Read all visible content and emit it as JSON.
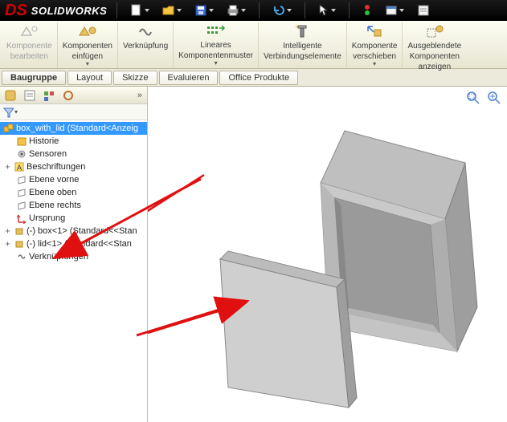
{
  "app": {
    "brand_prefix": "DS",
    "brand_name": "SOLIDWORKS"
  },
  "ribbon": {
    "groups": [
      {
        "label1": "Komponente",
        "label2": "bearbeiten",
        "gray": true
      },
      {
        "label1": "Komponenten",
        "label2": "einfügen"
      },
      {
        "label1": "Verknüpfung",
        "label2": ""
      },
      {
        "label1": "Lineares",
        "label2": "Komponentenmuster"
      },
      {
        "label1": "Intelligente",
        "label2": "Verbindungselemente"
      },
      {
        "label1": "Komponente",
        "label2": "verschieben"
      },
      {
        "label1": "Ausgeblendete",
        "label2": "Komponenten",
        "label3": "anzeigen"
      }
    ]
  },
  "tabs": [
    "Baugruppe",
    "Layout",
    "Skizze",
    "Evaluieren",
    "Office Produkte"
  ],
  "active_tab_index": 0,
  "tree": {
    "root": "box_with_lid  (Standard<Anzeig",
    "items": [
      {
        "label": "Historie"
      },
      {
        "label": "Sensoren"
      },
      {
        "label": "Beschriftungen"
      },
      {
        "label": "Ebene vorne"
      },
      {
        "label": "Ebene oben"
      },
      {
        "label": "Ebene rechts"
      },
      {
        "label": "Ursprung"
      },
      {
        "label": "(-) box<1> (Standard<<Stan"
      },
      {
        "label": "(-) lid<1> (Standard<<Stan"
      },
      {
        "label": "Verknüpfungen"
      }
    ]
  }
}
